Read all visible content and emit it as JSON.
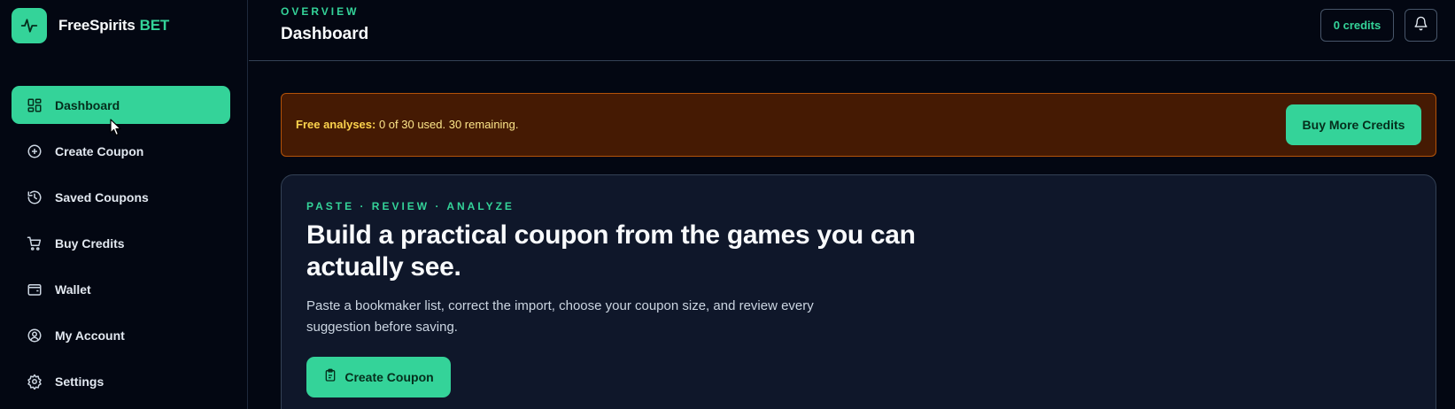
{
  "brand": {
    "name": "FreeSpirits",
    "accent": "BET",
    "logo_icon": "pulse-icon"
  },
  "sidebar": {
    "items": [
      {
        "label": "Dashboard",
        "icon": "dashboard-grid-icon",
        "active": true
      },
      {
        "label": "Create Coupon",
        "icon": "plus-circle-icon",
        "active": false
      },
      {
        "label": "Saved Coupons",
        "icon": "history-icon",
        "active": false
      },
      {
        "label": "Buy Credits",
        "icon": "cart-icon",
        "active": false
      },
      {
        "label": "Wallet",
        "icon": "wallet-icon",
        "active": false
      },
      {
        "label": "My Account",
        "icon": "user-circle-icon",
        "active": false
      },
      {
        "label": "Settings",
        "icon": "gear-icon",
        "active": false
      }
    ]
  },
  "header": {
    "eyebrow": "OVERVIEW",
    "title": "Dashboard",
    "credits_label": "0 credits",
    "bell_icon": "bell-icon"
  },
  "banner": {
    "label": "Free analyses:",
    "text": " 0 of 30 used. 30 remaining.",
    "button": "Buy More Credits"
  },
  "hero": {
    "eyebrow": "PASTE · REVIEW · ANALYZE",
    "title": "Build a practical coupon from the games you can actually see.",
    "description": "Paste a bookmaker list, correct the import, choose your coupon size, and review every suggestion before saving.",
    "button": "Create Coupon",
    "button_icon": "clipboard-icon"
  },
  "colors": {
    "accent": "#34d399",
    "background": "#030712",
    "card": "#0f172a",
    "banner_bg": "#451a03",
    "banner_border": "#b45309",
    "banner_text": "#fde68a"
  }
}
